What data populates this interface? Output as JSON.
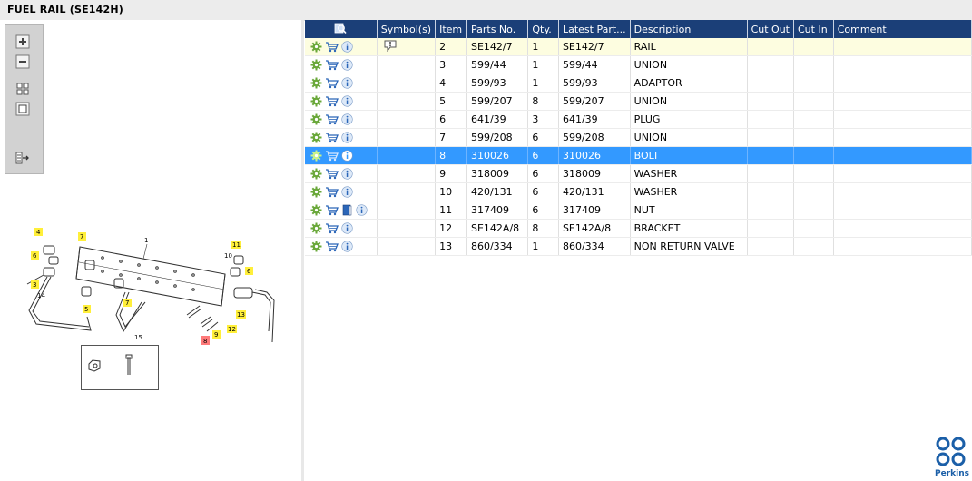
{
  "window": {
    "title": "FUEL RAIL (SE142H)"
  },
  "toolbar": {
    "buttons": [
      {
        "name": "zoom-in-button",
        "icon": "zoom-in-icon"
      },
      {
        "name": "zoom-out-button",
        "icon": "zoom-out-icon"
      },
      {
        "name": "fit-all-button",
        "icon": "fit-all-icon"
      },
      {
        "name": "fit-window-button",
        "icon": "fit-window-icon"
      },
      {
        "name": "export-list-button",
        "icon": "export-list-icon"
      }
    ]
  },
  "diagram": {
    "callouts": [
      "1",
      "4",
      "7",
      "6",
      "3",
      "14",
      "5",
      "7",
      "11",
      "10",
      "6",
      "13",
      "12",
      "9",
      "8",
      "15"
    ],
    "highlighted_callout": "8"
  },
  "table": {
    "columns": [
      "",
      "Symbol(s)",
      "Item",
      "Parts No.",
      "Qty.",
      "Latest Part...",
      "Description",
      "Cut Out",
      "Cut In",
      "Comment"
    ],
    "rows": [
      {
        "item": "2",
        "part_no": "SE142/7",
        "qty": "1",
        "latest": "SE142/7",
        "desc": "RAIL",
        "symbol": true,
        "state": "highlight"
      },
      {
        "item": "3",
        "part_no": "599/44",
        "qty": "1",
        "latest": "599/44",
        "desc": "UNION"
      },
      {
        "item": "4",
        "part_no": "599/93",
        "qty": "1",
        "latest": "599/93",
        "desc": "ADAPTOR"
      },
      {
        "item": "5",
        "part_no": "599/207",
        "qty": "8",
        "latest": "599/207",
        "desc": "UNION"
      },
      {
        "item": "6",
        "part_no": "641/39",
        "qty": "3",
        "latest": "641/39",
        "desc": "PLUG"
      },
      {
        "item": "7",
        "part_no": "599/208",
        "qty": "6",
        "latest": "599/208",
        "desc": "UNION"
      },
      {
        "item": "8",
        "part_no": "310026",
        "qty": "6",
        "latest": "310026",
        "desc": "BOLT",
        "state": "selected"
      },
      {
        "item": "9",
        "part_no": "318009",
        "qty": "6",
        "latest": "318009",
        "desc": "WASHER"
      },
      {
        "item": "10",
        "part_no": "420/131",
        "qty": "6",
        "latest": "420/131",
        "desc": "WASHER"
      },
      {
        "item": "11",
        "part_no": "317409",
        "qty": "6",
        "latest": "317409",
        "desc": "NUT",
        "book": true
      },
      {
        "item": "12",
        "part_no": "SE142A/8",
        "qty": "8",
        "latest": "SE142A/8",
        "desc": "BRACKET"
      },
      {
        "item": "13",
        "part_no": "860/334",
        "qty": "1",
        "latest": "860/334",
        "desc": "NON RETURN VALVE"
      }
    ]
  },
  "brand": {
    "name": "Perkins",
    "color": "#1b5fa8"
  },
  "colors": {
    "header": "#1b3f78",
    "selected": "#3399ff",
    "highlight": "#fdfde0",
    "gear": "#6aa83a"
  }
}
